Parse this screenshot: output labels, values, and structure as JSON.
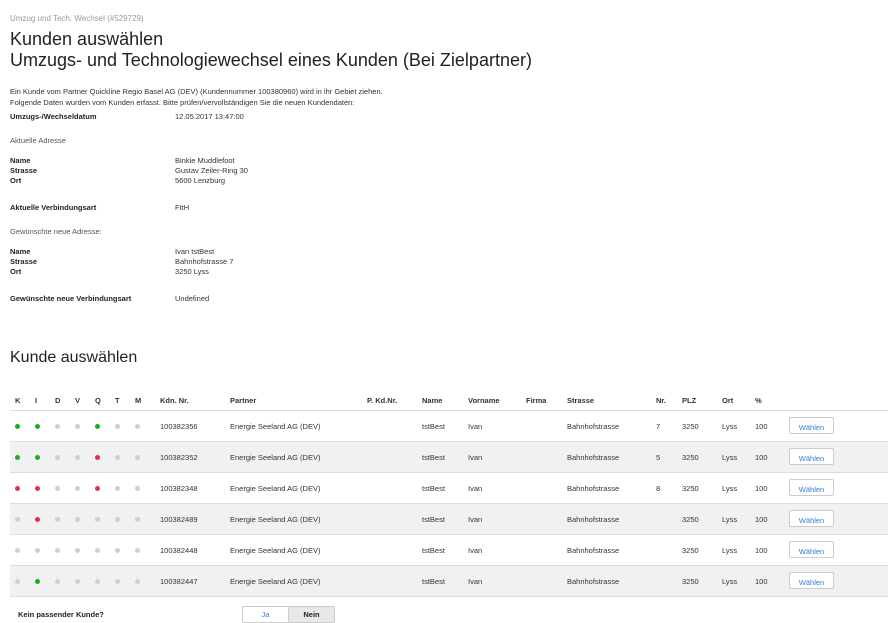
{
  "breadcrumb": "Umzug und Tech. Wechsel (#529729)",
  "title": "Kunden auswählen",
  "subtitle": "Umzugs- und Technologiewechsel eines Kunden (Bei Zielpartner)",
  "intro_text": "Ein Kunde vom Partner Quickline Regio Basel AG (DEV) (Kundennummer 100380960) wird in ihr Gebiet ziehen. Folgende Daten wurden vom Kunden erfasst. Bitte prüfen/vervollständigen Sie die neuen Kundendaten:",
  "details": {
    "date_label": "Umzugs-/Wechseldatum",
    "date_value": "12.05.2017 13:47:00",
    "current_address_heading": "Aktuelle Adresse",
    "current": {
      "name_label": "Name",
      "name_value": "Binkie Muddlefoot",
      "street_label": "Strasse",
      "street_value": "Gustav Zeiler-Ring 30",
      "city_label": "Ort",
      "city_value": "5600 Lenzburg"
    },
    "conn_label": "Aktuelle Verbindungsart",
    "conn_value": "FttH",
    "new_address_heading": "Gewünschte neue Adresse:",
    "new": {
      "name_label": "Name",
      "name_value": "Ivan tstBest",
      "street_label": "Strasse",
      "street_value": "Bahnhofstrasse 7",
      "city_label": "Ort",
      "city_value": "3250 Lyss"
    },
    "new_conn_label": "Gewünschte neue Verbindungsart",
    "new_conn_value": "Undefined"
  },
  "select_heading": "Kunde auswählen",
  "table": {
    "headers": [
      "K",
      "I",
      "D",
      "V",
      "Q",
      "T",
      "M",
      "Kdn. Nr.",
      "Partner",
      "P. Kd.Nr.",
      "Name",
      "Vorname",
      "Firma",
      "Strasse",
      "Nr.",
      "PLZ",
      "Ort",
      "%"
    ],
    "status_colors": {
      "green": "#22aa22",
      "red": "#e0304a",
      "grey": "#cfcfcf"
    },
    "rows": [
      {
        "dots": [
          "green",
          "green",
          "grey",
          "grey",
          "green",
          "grey",
          "grey"
        ],
        "kdn": "100382356",
        "partner": "Energie Seeland AG (DEV)",
        "pkd": "",
        "name": "tstBest",
        "vorname": "Ivan",
        "firma": "",
        "strasse": "Bahnhofstrasse",
        "nr": "7",
        "plz": "3250",
        "ort": "Lyss",
        "pct": "100",
        "button": "Wählen"
      },
      {
        "dots": [
          "green",
          "green",
          "grey",
          "grey",
          "red",
          "grey",
          "grey"
        ],
        "kdn": "100382352",
        "partner": "Energie Seeland AG (DEV)",
        "pkd": "",
        "name": "tstBest",
        "vorname": "Ivan",
        "firma": "",
        "strasse": "Bahnhofstrasse",
        "nr": "5",
        "plz": "3250",
        "ort": "Lyss",
        "pct": "100",
        "button": "Wählen"
      },
      {
        "dots": [
          "red",
          "red",
          "grey",
          "grey",
          "red",
          "grey",
          "grey"
        ],
        "kdn": "100382348",
        "partner": "Energie Seeland AG (DEV)",
        "pkd": "",
        "name": "tstBest",
        "vorname": "Ivan",
        "firma": "",
        "strasse": "Bahnhofstrasse",
        "nr": "8",
        "plz": "3250",
        "ort": "Lyss",
        "pct": "100",
        "button": "Wählen"
      },
      {
        "dots": [
          "grey",
          "red",
          "grey",
          "grey",
          "grey",
          "grey",
          "grey"
        ],
        "kdn": "100382489",
        "partner": "Energie Seeland AG (DEV)",
        "pkd": "",
        "name": "tstBest",
        "vorname": "Ivan",
        "firma": "",
        "strasse": "Bahnhofstrasse",
        "nr": "",
        "plz": "3250",
        "ort": "Lyss",
        "pct": "100",
        "button": "Wählen"
      },
      {
        "dots": [
          "grey",
          "grey",
          "grey",
          "grey",
          "grey",
          "grey",
          "grey"
        ],
        "kdn": "100382448",
        "partner": "Energie Seeland AG (DEV)",
        "pkd": "",
        "name": "tstBest",
        "vorname": "Ivan",
        "firma": "",
        "strasse": "Bahnhofstrasse",
        "nr": "",
        "plz": "3250",
        "ort": "Lyss",
        "pct": "100",
        "button": "Wählen"
      },
      {
        "dots": [
          "grey",
          "green",
          "grey",
          "grey",
          "grey",
          "grey",
          "grey"
        ],
        "kdn": "100382447",
        "partner": "Energie Seeland AG (DEV)",
        "pkd": "",
        "name": "tstBest",
        "vorname": "Ivan",
        "firma": "",
        "strasse": "Bahnhofstrasse",
        "nr": "",
        "plz": "3250",
        "ort": "Lyss",
        "pct": "100",
        "button": "Wählen"
      }
    ]
  },
  "footer": {
    "question": "Kein passender Kunde?",
    "yes_label": "Ja",
    "no_label": "Nein",
    "selected": "Nein"
  }
}
